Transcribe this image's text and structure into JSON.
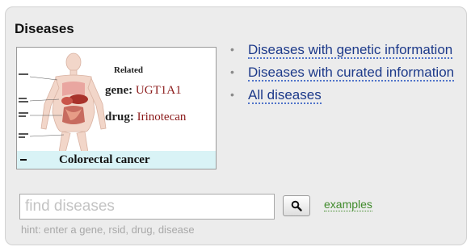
{
  "panel": {
    "title": "Diseases"
  },
  "figure": {
    "related_label": "Related",
    "gene_key": "gene:",
    "gene_value": "UGT1A1",
    "drug_key": "drug:",
    "drug_value": "Irinotecan",
    "caption": "Colorectal cancer"
  },
  "links": [
    {
      "label": "Diseases with genetic information"
    },
    {
      "label": "Diseases with curated information"
    },
    {
      "label": "All diseases"
    }
  ],
  "search": {
    "placeholder": "find diseases",
    "value": "",
    "button_icon": "search-icon",
    "examples_label": "examples",
    "hint": "hint: enter a gene, rsid, drug, disease"
  },
  "colors": {
    "link": "#1d3a8a",
    "examples_link": "#3f8a2a",
    "caption_bg": "#d9f3f6",
    "panel_bg": "#ececec"
  }
}
